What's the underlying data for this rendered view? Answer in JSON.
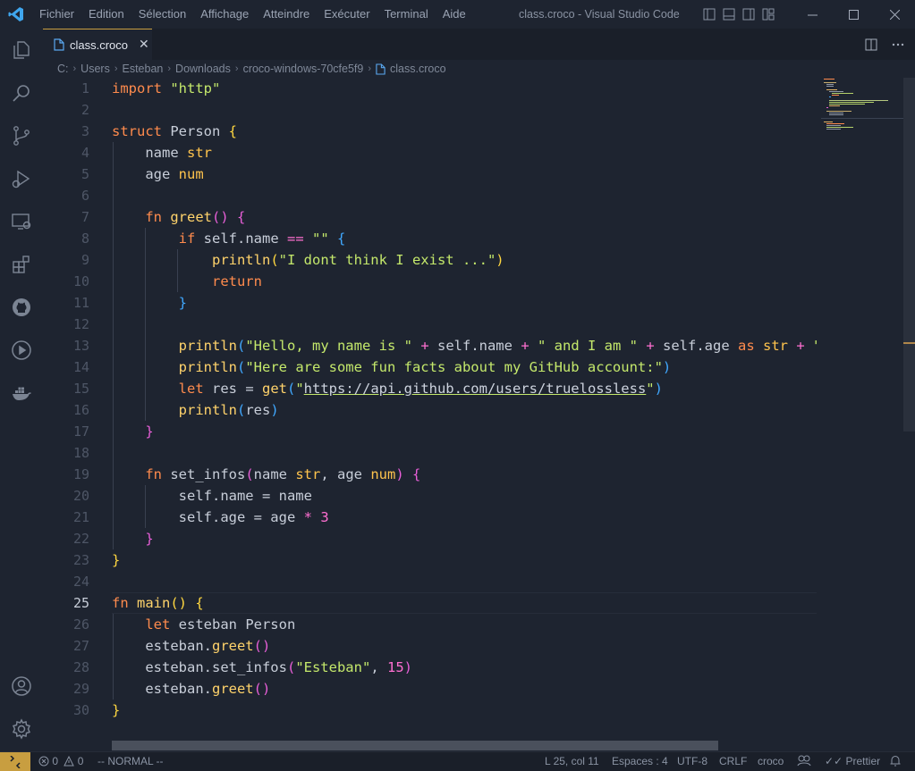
{
  "window": {
    "title": "class.croco - Visual Studio Code",
    "menu": [
      "Fichier",
      "Edition",
      "Sélection",
      "Affichage",
      "Atteindre",
      "Exécuter",
      "Terminal",
      "Aide"
    ]
  },
  "tab": {
    "label": "class.croco"
  },
  "breadcrumb": [
    "C:",
    "Users",
    "Esteban",
    "Downloads",
    "croco-windows-70cfe5f9",
    "class.croco"
  ],
  "editor": {
    "active_line": 25,
    "lines": [
      [
        [
          "kw",
          "import"
        ],
        [
          "pn",
          " "
        ],
        [
          "st",
          "\"http\""
        ]
      ],
      [],
      [
        [
          "kw",
          "struct"
        ],
        [
          "pn",
          " Person "
        ],
        [
          "b1",
          "{"
        ]
      ],
      [
        [
          "pn",
          "    name "
        ],
        [
          "ty",
          "str"
        ]
      ],
      [
        [
          "pn",
          "    age "
        ],
        [
          "ty",
          "num"
        ]
      ],
      [],
      [
        [
          "pn",
          "    "
        ],
        [
          "kw",
          "fn"
        ],
        [
          "pn",
          " "
        ],
        [
          "fn",
          "greet"
        ],
        [
          "b2",
          "()"
        ],
        [
          "pn",
          " "
        ],
        [
          "b2",
          "{"
        ]
      ],
      [
        [
          "pn",
          "        "
        ],
        [
          "kw",
          "if"
        ],
        [
          "pn",
          " self.name "
        ],
        [
          "op",
          "=="
        ],
        [
          "pn",
          " "
        ],
        [
          "st",
          "\"\""
        ],
        [
          "pn",
          " "
        ],
        [
          "b3",
          "{"
        ]
      ],
      [
        [
          "pn",
          "            "
        ],
        [
          "fn",
          "println"
        ],
        [
          "b1",
          "("
        ],
        [
          "st",
          "\"I dont think I exist ...\""
        ],
        [
          "b1",
          ")"
        ]
      ],
      [
        [
          "pn",
          "            "
        ],
        [
          "kw",
          "return"
        ]
      ],
      [
        [
          "pn",
          "        "
        ],
        [
          "b3",
          "}"
        ]
      ],
      [],
      [
        [
          "pn",
          "        "
        ],
        [
          "fn",
          "println"
        ],
        [
          "b3",
          "("
        ],
        [
          "st",
          "\"Hello, my name is \""
        ],
        [
          "pn",
          " "
        ],
        [
          "op",
          "+"
        ],
        [
          "pn",
          " self.name "
        ],
        [
          "op",
          "+"
        ],
        [
          "pn",
          " "
        ],
        [
          "st",
          "\" and I am \""
        ],
        [
          "pn",
          " "
        ],
        [
          "op",
          "+"
        ],
        [
          "pn",
          " self.age "
        ],
        [
          "kw",
          "as"
        ],
        [
          "pn",
          " "
        ],
        [
          "ty",
          "str"
        ],
        [
          "pn",
          " "
        ],
        [
          "op",
          "+"
        ],
        [
          "pn",
          " "
        ],
        [
          "st",
          "\" years old\""
        ],
        [
          "b3",
          ")"
        ]
      ],
      [
        [
          "pn",
          "        "
        ],
        [
          "fn",
          "println"
        ],
        [
          "b3",
          "("
        ],
        [
          "st",
          "\"Here are some fun facts about my GitHub account:\""
        ],
        [
          "b3",
          ")"
        ]
      ],
      [
        [
          "pn",
          "        "
        ],
        [
          "kw",
          "let"
        ],
        [
          "pn",
          " res = "
        ],
        [
          "fn",
          "get"
        ],
        [
          "b3",
          "("
        ],
        [
          "st",
          "\""
        ],
        [
          "lnk",
          "https://api.github.com/users/truelossless"
        ],
        [
          "st",
          "\""
        ],
        [
          "b3",
          ")"
        ]
      ],
      [
        [
          "pn",
          "        "
        ],
        [
          "fn",
          "println"
        ],
        [
          "b3",
          "("
        ],
        [
          "pn",
          "res"
        ],
        [
          "b3",
          ")"
        ]
      ],
      [
        [
          "pn",
          "    "
        ],
        [
          "b2",
          "}"
        ]
      ],
      [],
      [
        [
          "pn",
          "    "
        ],
        [
          "kw",
          "fn"
        ],
        [
          "pn",
          " set_infos"
        ],
        [
          "b2",
          "("
        ],
        [
          "pn",
          "name "
        ],
        [
          "ty",
          "str"
        ],
        [
          "pn",
          ", age "
        ],
        [
          "ty",
          "num"
        ],
        [
          "b2",
          ")"
        ],
        [
          "pn",
          " "
        ],
        [
          "b2",
          "{"
        ]
      ],
      [
        [
          "pn",
          "        self.name = name"
        ]
      ],
      [
        [
          "pn",
          "        self.age = age "
        ],
        [
          "op",
          "*"
        ],
        [
          "pn",
          " "
        ],
        [
          "nm",
          "3"
        ]
      ],
      [
        [
          "pn",
          "    "
        ],
        [
          "b2",
          "}"
        ]
      ],
      [
        [
          "b1",
          "}"
        ]
      ],
      [],
      [
        [
          "kw",
          "fn"
        ],
        [
          "pn",
          " "
        ],
        [
          "fn",
          "main"
        ],
        [
          "b1",
          "()"
        ],
        [
          "pn",
          " "
        ],
        [
          "b1",
          "{"
        ]
      ],
      [
        [
          "pn",
          "    "
        ],
        [
          "kw",
          "let"
        ],
        [
          "pn",
          " esteban Person"
        ]
      ],
      [
        [
          "pn",
          "    esteban."
        ],
        [
          "fn",
          "greet"
        ],
        [
          "b2",
          "()"
        ]
      ],
      [
        [
          "pn",
          "    esteban.set_infos"
        ],
        [
          "b2",
          "("
        ],
        [
          "st",
          "\"Esteban\""
        ],
        [
          "pn",
          ", "
        ],
        [
          "nm",
          "15"
        ],
        [
          "b2",
          ")"
        ]
      ],
      [
        [
          "pn",
          "    esteban."
        ],
        [
          "fn",
          "greet"
        ],
        [
          "b2",
          "()"
        ]
      ],
      [
        [
          "b1",
          "}"
        ]
      ]
    ]
  },
  "status": {
    "errors": "0",
    "warnings": "0",
    "mode": "-- NORMAL --",
    "position": "L 25, col 11",
    "indent": "Espaces : 4",
    "encoding": "UTF-8",
    "eol": "CRLF",
    "language": "croco",
    "formatter": "Prettier"
  },
  "colors": {
    "accent": "#c89e40",
    "background": "#1e2430"
  },
  "icons": [
    "vscode-logo-icon",
    "explorer-icon",
    "search-icon",
    "source-control-icon",
    "run-debug-icon",
    "remote-explorer-icon",
    "extensions-icon",
    "github-icon",
    "run-icon",
    "docker-icon",
    "account-icon",
    "settings-gear-icon",
    "file-icon",
    "close-icon",
    "split-editor-icon",
    "more-actions-icon",
    "bell-icon"
  ]
}
